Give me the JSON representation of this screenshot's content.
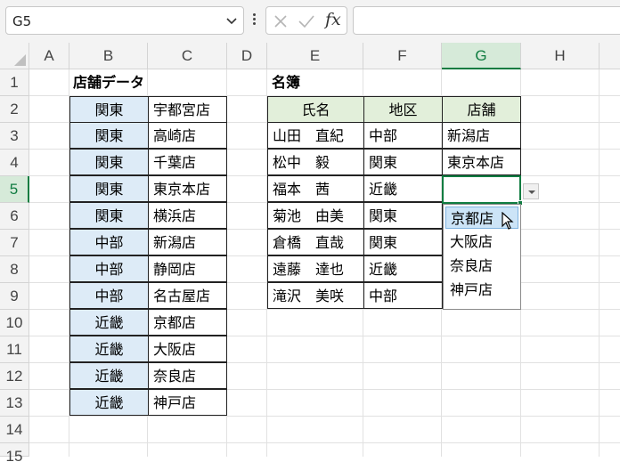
{
  "formula_bar": {
    "name_box": "G5",
    "fx_label": "fx",
    "formula": ""
  },
  "columns": [
    "A",
    "B",
    "C",
    "D",
    "E",
    "F",
    "G",
    "H"
  ],
  "rows": [
    "1",
    "2",
    "3",
    "4",
    "5",
    "6",
    "7",
    "8",
    "9",
    "10",
    "11",
    "12",
    "13",
    "14",
    "15"
  ],
  "selected": {
    "column": "G",
    "row": "5"
  },
  "store_table": {
    "title": "店舗データ",
    "rows": [
      [
        "関東",
        "宇都宮店"
      ],
      [
        "関東",
        "高崎店"
      ],
      [
        "関東",
        "千葉店"
      ],
      [
        "関東",
        "東京本店"
      ],
      [
        "関東",
        "横浜店"
      ],
      [
        "中部",
        "新潟店"
      ],
      [
        "中部",
        "静岡店"
      ],
      [
        "中部",
        "名古屋店"
      ],
      [
        "近畿",
        "京都店"
      ],
      [
        "近畿",
        "大阪店"
      ],
      [
        "近畿",
        "奈良店"
      ],
      [
        "近畿",
        "神戸店"
      ]
    ]
  },
  "roster": {
    "title": "名簿",
    "headers": [
      "氏名",
      "地区",
      "店舗"
    ],
    "rows": [
      [
        "山田　直紀",
        "中部",
        "新潟店"
      ],
      [
        "松中　毅",
        "関東",
        "東京本店"
      ],
      [
        "福本　茜",
        "近畿",
        ""
      ],
      [
        "菊池　由美",
        "関東",
        ""
      ],
      [
        "倉橋　直哉",
        "関東",
        ""
      ],
      [
        "遠藤　達也",
        "近畿",
        ""
      ],
      [
        "滝沢　美咲",
        "中部",
        ""
      ]
    ]
  },
  "dropdown": {
    "options": [
      "京都店",
      "大阪店",
      "奈良店",
      "神戸店"
    ],
    "highlighted": "京都店"
  },
  "colors": {
    "accent": "#107c41",
    "store_region_fill": "#ddebf7",
    "roster_header_fill": "#e2efda"
  }
}
